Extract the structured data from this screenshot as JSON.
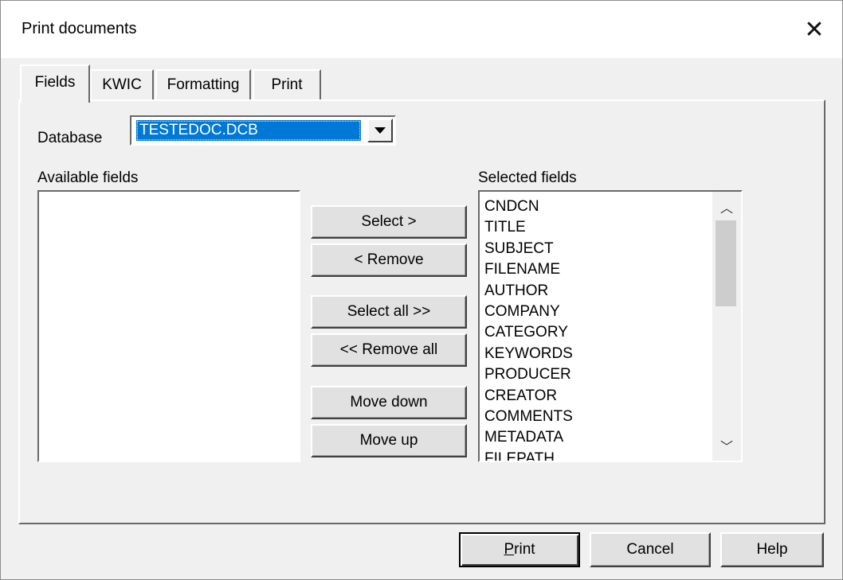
{
  "window": {
    "title": "Print documents"
  },
  "tabs": [
    {
      "label": "Fields",
      "active": true
    },
    {
      "label": "KWIC",
      "active": false
    },
    {
      "label": "Formatting",
      "active": false
    },
    {
      "label": "Print",
      "active": false
    }
  ],
  "database": {
    "label": "Database",
    "value": "TESTEDOC.DCB"
  },
  "available": {
    "label": "Available fields",
    "items": []
  },
  "selected": {
    "label": "Selected fields",
    "items": [
      "CNDCN",
      "TITLE",
      "SUBJECT",
      "FILENAME",
      "AUTHOR",
      "COMPANY",
      "CATEGORY",
      "KEYWORDS",
      "PRODUCER",
      "CREATOR",
      "COMMENTS",
      "METADATA",
      "FILEPATH"
    ]
  },
  "buttons": {
    "select": "Select >",
    "remove": "< Remove",
    "select_all": "Select all >>",
    "remove_all": "<< Remove all",
    "move_down": "Move down",
    "move_up": "Move up"
  },
  "footer": {
    "print_mnemonic": "P",
    "print_rest": "rint",
    "cancel": "Cancel",
    "help": "Help"
  },
  "icons": {
    "close": "close-icon",
    "dropdown": "chevron-down-icon",
    "scroll_up": "scroll-up-icon",
    "scroll_down": "scroll-down-icon"
  },
  "colors": {
    "selection": "#0078d7",
    "face": "#f0f0f0"
  }
}
